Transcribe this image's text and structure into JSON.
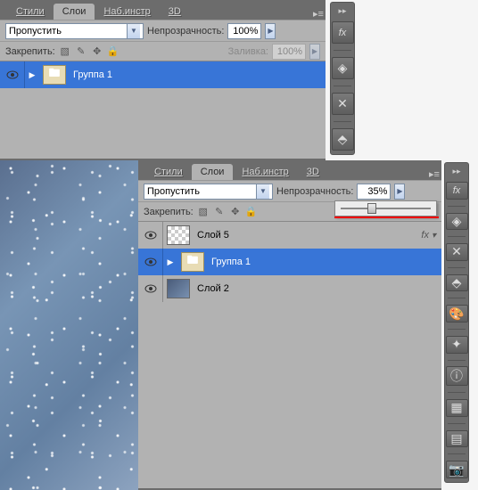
{
  "panel1": {
    "tabs": [
      "Стили",
      "Слои",
      "Наб.инстр",
      "3D"
    ],
    "active_tab": 1,
    "blend_mode": "Пропустить",
    "opacity_label": "Непрозрачность:",
    "opacity_value": "100%",
    "lock_label": "Закрепить:",
    "fill_label": "Заливка:",
    "fill_value": "100%",
    "layers": [
      {
        "name": "Группа 1",
        "type": "group",
        "selected": true
      }
    ]
  },
  "panel2": {
    "tabs": [
      "Стили",
      "Слои",
      "Наб.инстр",
      "3D"
    ],
    "active_tab": 1,
    "blend_mode": "Пропустить",
    "opacity_label": "Непрозрачность:",
    "opacity_value": "35%",
    "slider_percent": 35,
    "lock_label": "Закрепить:",
    "layers": [
      {
        "name": "Слой 5",
        "type": "raster",
        "selected": false,
        "fx": true
      },
      {
        "name": "Группа 1",
        "type": "group",
        "selected": true
      },
      {
        "name": "Слой 2",
        "type": "raster",
        "selected": false
      }
    ]
  },
  "fx_label": "fx"
}
